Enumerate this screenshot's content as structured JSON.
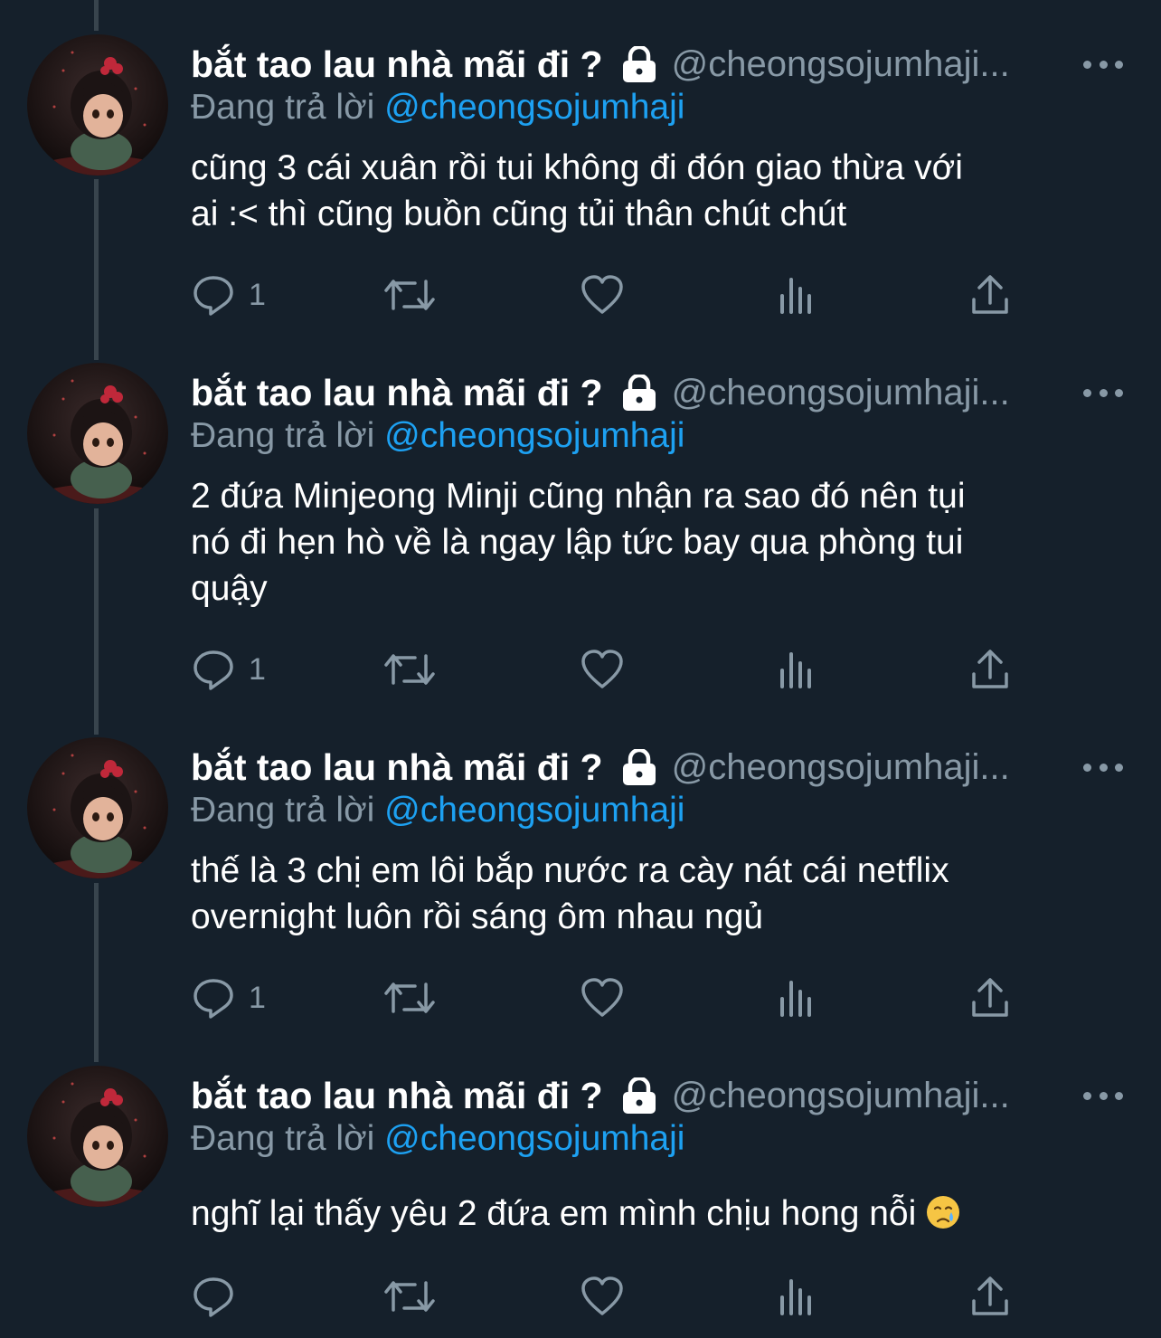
{
  "accent_color": "#1da1f2",
  "muted_color": "#8899a6",
  "background_color": "#15202b",
  "tweets": [
    {
      "display_name": "bắt tao lau nhà mãi đi ?",
      "handle": "@cheongsojumhaji...",
      "replying_prefix": "Đang trả lời",
      "replying_to": "@cheongsojumhaji",
      "text_lines": [
        "cũng 3 cái xuân rồi tui không đi đón giao thừa với",
        "ai :< thì cũng buồn cũng tủi thân chút chút"
      ],
      "reply_count": "1"
    },
    {
      "display_name": "bắt tao lau nhà mãi đi ?",
      "handle": "@cheongsojumhaji...",
      "replying_prefix": "Đang trả lời",
      "replying_to": "@cheongsojumhaji",
      "text_lines": [
        "2 đứa Minjeong Minji cũng nhận ra sao đó nên tụi",
        "nó đi hẹn hò về là ngay lập tức bay qua phòng tui",
        "quậy"
      ],
      "reply_count": "1"
    },
    {
      "display_name": "bắt tao lau nhà mãi đi ?",
      "handle": "@cheongsojumhaji...",
      "replying_prefix": "Đang trả lời",
      "replying_to": "@cheongsojumhaji",
      "text_lines": [
        "thế là 3 chị em lôi bắp nước ra cày nát cái netflix",
        "overnight luôn rồi sáng ôm nhau ngủ"
      ],
      "reply_count": "1"
    },
    {
      "display_name": "bắt tao lau nhà mãi đi ?",
      "handle": "@cheongsojumhaji...",
      "replying_prefix": "Đang trả lời",
      "replying_to": "@cheongsojumhaji",
      "text_lines": [
        "nghĩ lại thấy yêu 2 đứa em mình chịu hong nỗi"
      ],
      "reply_count": "",
      "trailing_emoji": "crying-face"
    }
  ]
}
